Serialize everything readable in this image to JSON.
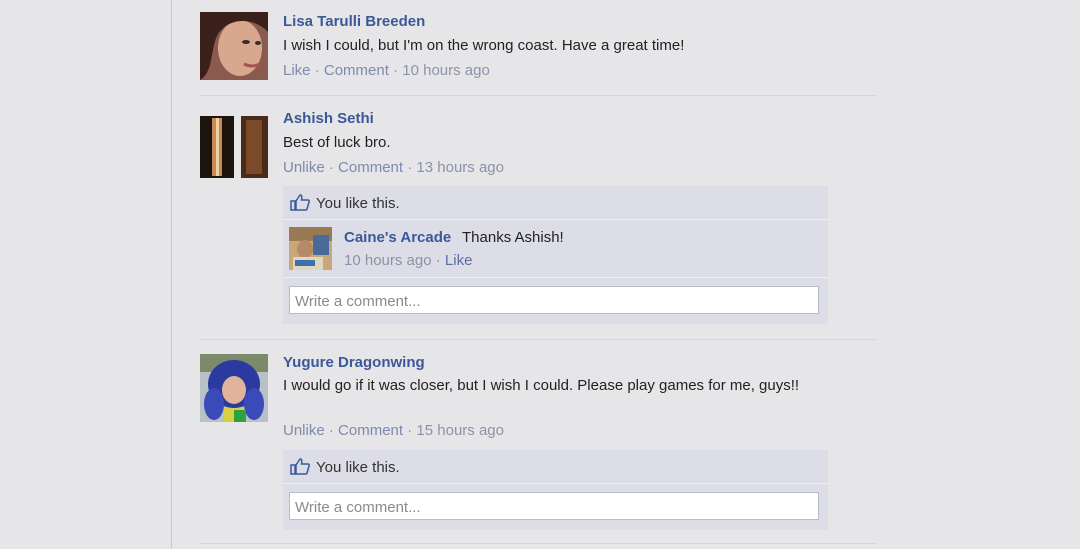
{
  "comments": [
    {
      "author": "Lisa Tarulli Breeden",
      "text": "I wish I could, but I'm on the wrong coast. Have a great time!",
      "like_action": "Like",
      "comment_action": "Comment",
      "time": "10 hours ago"
    },
    {
      "author": "Ashish Sethi",
      "text": "Best of luck bro.",
      "like_action": "Unlike",
      "comment_action": "Comment",
      "time": "13 hours ago",
      "likes_text": "You like this.",
      "reply": {
        "author": "Caine's Arcade",
        "text": "Thanks Ashish!",
        "time": "10 hours ago",
        "like_action": "Like"
      },
      "write_placeholder": "Write a comment..."
    },
    {
      "author": "Yugure Dragonwing",
      "text": "I would go if it was closer, but I wish I could. Please play games for me, guys!!",
      "like_action": "Unlike",
      "comment_action": "Comment",
      "time": "15 hours ago",
      "likes_text": "You like this.",
      "write_placeholder": "Write a comment..."
    }
  ],
  "separator": " · ",
  "icons": {
    "like": "thumbs-up-icon"
  },
  "colors": {
    "link": "#3b5998",
    "meta": "#8c93a8",
    "panel": "#dcdde6",
    "background": "#e6e6e8"
  }
}
